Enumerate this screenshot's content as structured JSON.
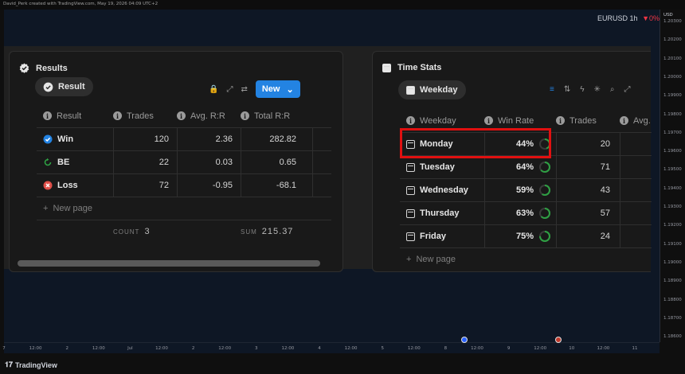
{
  "caption": "David_Perk created with TradingView.com, May 19, 2026 04:09 UTC+2",
  "chart": {
    "symbol": "EURUSD",
    "interval": "1h",
    "change": "▼0%",
    "currency": "USD",
    "price_labels": [
      "1.20300",
      "1.20200",
      "1.20100",
      "1.20000",
      "1.19900",
      "1.19800",
      "1.19700",
      "1.19600",
      "1.19500",
      "1.19400",
      "1.19300",
      "1.19200",
      "1.19100",
      "1.19000",
      "1.18900",
      "1.18800",
      "1.18700",
      "1.18600"
    ],
    "time_labels": [
      "7",
      "12:00",
      "2",
      "12:00",
      "Jul",
      "12:00",
      "2",
      "12:00",
      "3",
      "12:00",
      "4",
      "12:00",
      "5",
      "12:00",
      "8",
      "12:00",
      "9",
      "12:00",
      "10",
      "12:00",
      "11"
    ],
    "brand": "TradingView"
  },
  "results": {
    "title": "Results",
    "view_label": "Result",
    "new_label": "New",
    "headers": [
      "Result",
      "Trades",
      "Avg. R:R",
      "Total R:R"
    ],
    "rows": [
      {
        "result": "Win",
        "trades": "120",
        "avg": "2.36",
        "total": "282.82",
        "icon": "check-circle-icon",
        "color": "#2383e2"
      },
      {
        "result": "BE",
        "trades": "22",
        "avg": "0.03",
        "total": "0.65",
        "icon": "refresh-icon",
        "color": "#2ea043"
      },
      {
        "result": "Loss",
        "trades": "72",
        "avg": "-0.95",
        "total": "-68.1",
        "icon": "x-circle-icon",
        "color": "#e0504a"
      }
    ],
    "new_page": "New page",
    "count_label": "COUNT",
    "count_value": "3",
    "sum_label": "SUM",
    "sum_value": "215.37"
  },
  "time_stats": {
    "title": "Time Stats",
    "view_label": "Weekday",
    "headers": [
      "Weekday",
      "Win Rate",
      "Trades",
      "Avg."
    ],
    "rows": [
      {
        "day": "Monday",
        "win_rate": "44%",
        "rate": 0.44,
        "trades": "20"
      },
      {
        "day": "Tuesday",
        "win_rate": "64%",
        "rate": 0.64,
        "trades": "71"
      },
      {
        "day": "Wednesday",
        "win_rate": "59%",
        "rate": 0.59,
        "trades": "43"
      },
      {
        "day": "Thursday",
        "win_rate": "63%",
        "rate": 0.63,
        "trades": "57"
      },
      {
        "day": "Friday",
        "win_rate": "75%",
        "rate": 0.75,
        "trades": "24"
      }
    ],
    "new_page": "New page"
  },
  "colors": {
    "accent": "#2383e2",
    "highlight": "#e01010",
    "ring": "#2ea043"
  }
}
